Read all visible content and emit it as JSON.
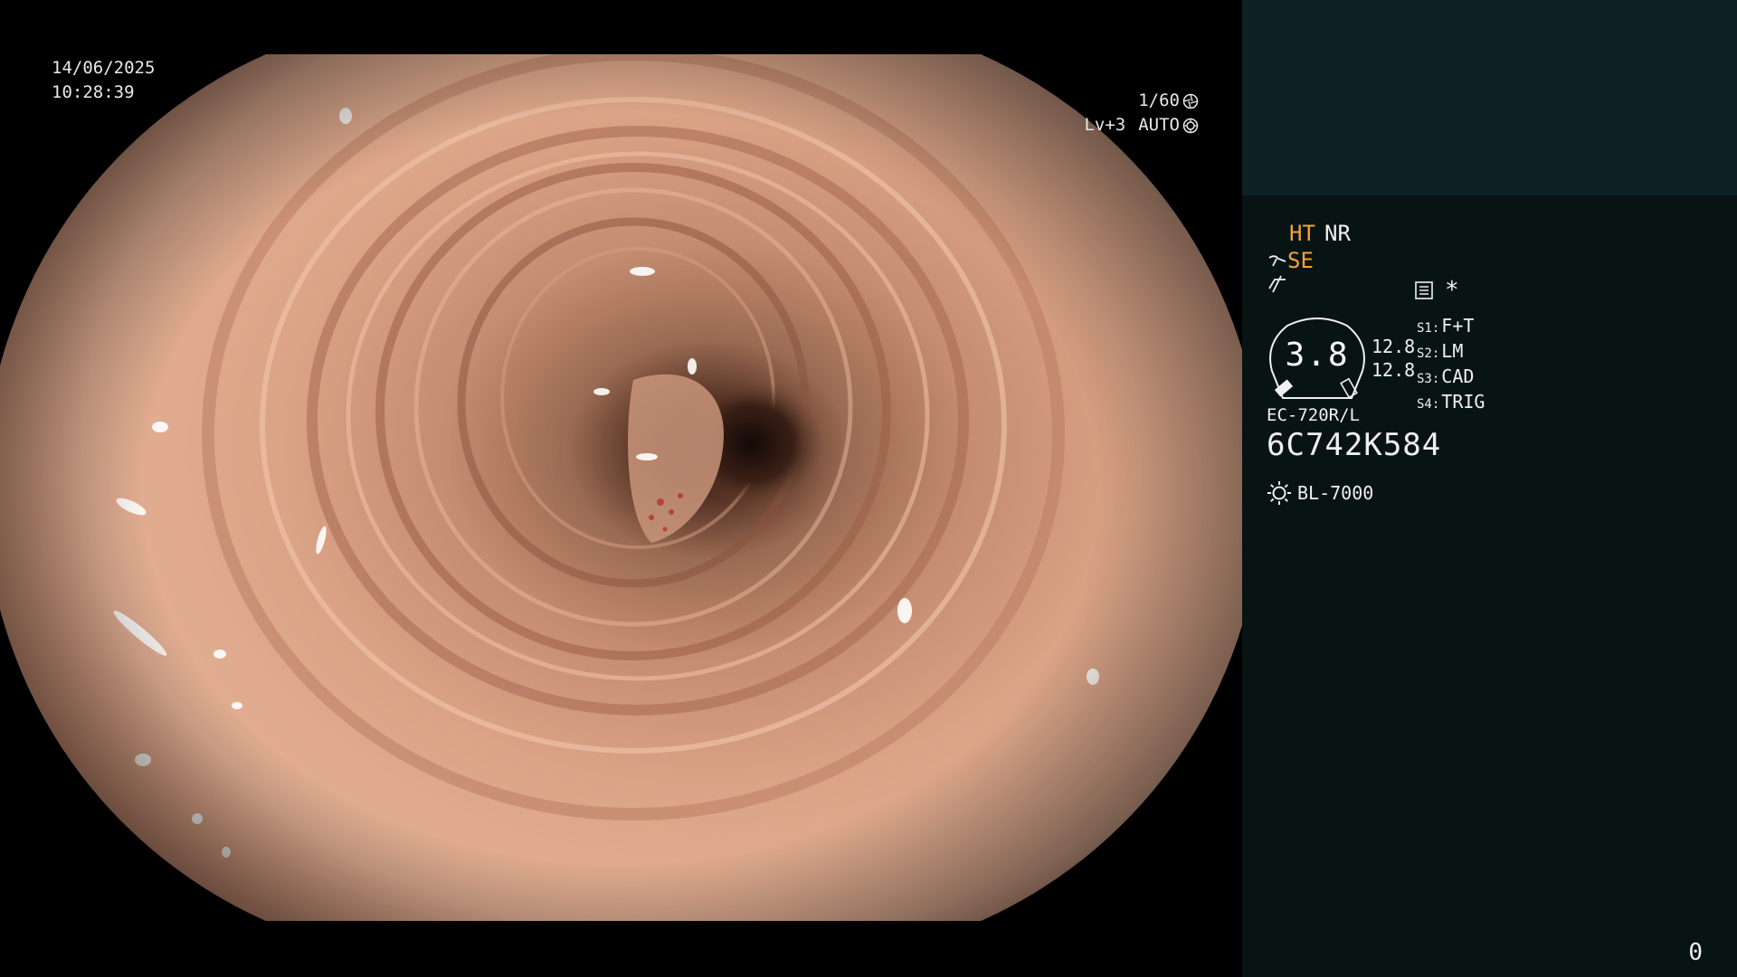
{
  "osd": {
    "date": "14/06/2025",
    "time": "10:28:39",
    "shutter": "1/60",
    "level": "Lv+3",
    "iris": "AUTO"
  },
  "panel": {
    "ht": "HT",
    "nr": "NR",
    "se": "SE",
    "gauge_value": "3.8",
    "gauge_left": "12.8",
    "gauge_right": "12.8",
    "asterisk": "*",
    "switches": [
      {
        "key": "S1:",
        "value": "F+T"
      },
      {
        "key": "S2:",
        "value": "LM"
      },
      {
        "key": "S3:",
        "value": "CAD"
      },
      {
        "key": "S4:",
        "value": "TRIG"
      }
    ],
    "scope_model": "EC-720R/L",
    "scope_serial": "6C742K584",
    "light_source": "BL-7000",
    "counter": "0"
  },
  "colors": {
    "panel_bg": "#081313",
    "panel_top_bg": "#0d2224",
    "accent_orange": "#f2a23a",
    "text": "#f0f0f0"
  },
  "icons": {
    "shutter": "aperture-icon",
    "iris": "iris-icon",
    "se_prefix": "scissors-icon",
    "wave": "wave-icon",
    "menu": "menu-list-icon",
    "light": "sun-icon"
  }
}
